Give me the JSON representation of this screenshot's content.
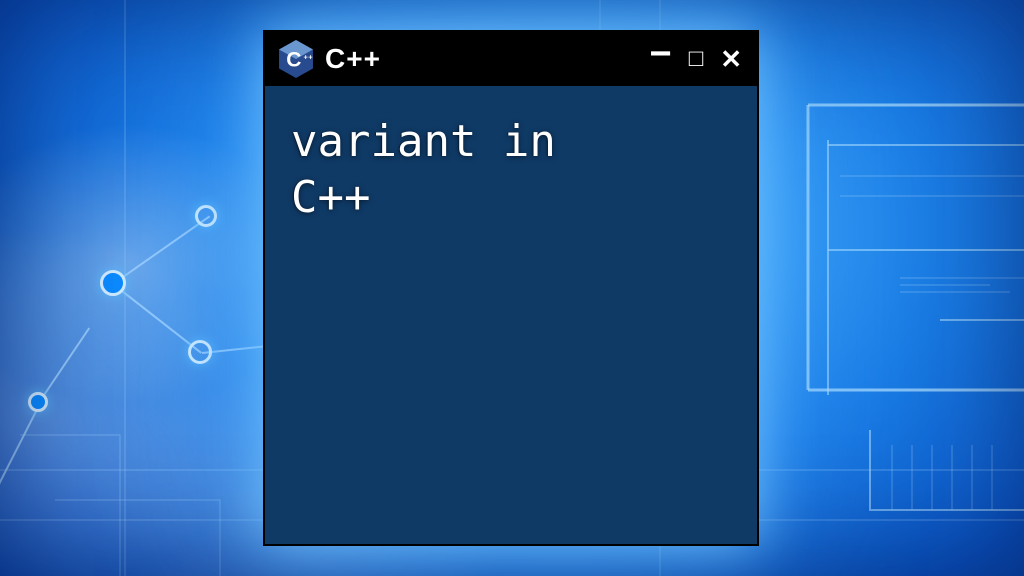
{
  "window": {
    "title": "C++",
    "controls": {
      "minimize": "−",
      "maximize": "□",
      "close": "✕"
    }
  },
  "logo": {
    "name": "cpp-hex-logo",
    "letter": "C",
    "plusplus": "++",
    "colors": {
      "top": "#6a97d0",
      "bottom": "#274b8e",
      "text": "#ffffff"
    }
  },
  "content": {
    "line1": "variant in",
    "line2": "C++"
  }
}
